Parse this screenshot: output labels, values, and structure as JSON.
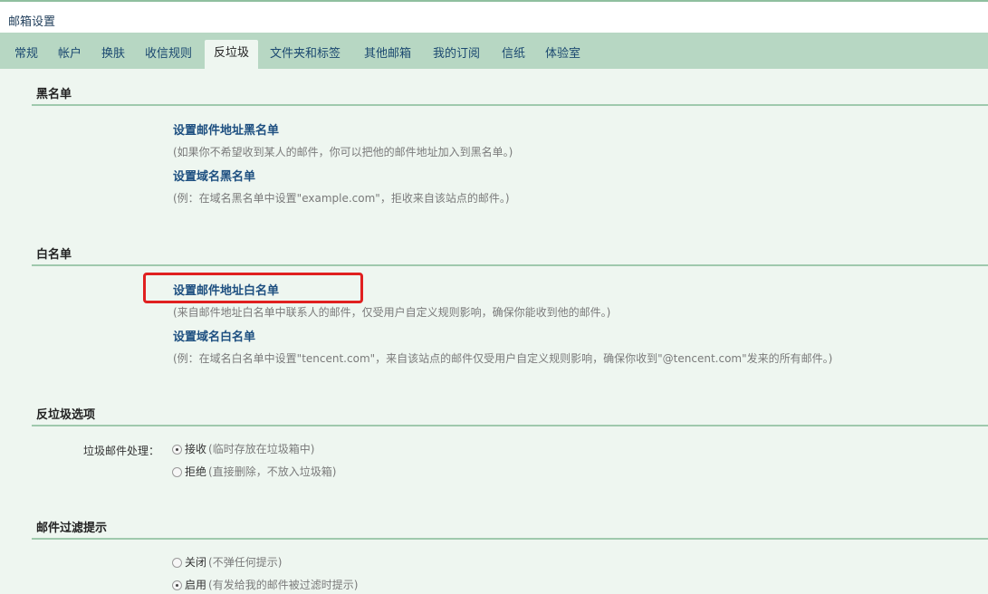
{
  "header": {
    "title": "邮箱设置"
  },
  "tabs": [
    {
      "label": "常规"
    },
    {
      "label": "帐户"
    },
    {
      "label": "换肤"
    },
    {
      "label": "收信规则"
    },
    {
      "label": "反垃圾"
    },
    {
      "label": "文件夹和标签"
    },
    {
      "label": "其他邮箱"
    },
    {
      "label": "我的订阅"
    },
    {
      "label": "信纸"
    },
    {
      "label": "体验室"
    }
  ],
  "active_tab": "反垃圾",
  "blacklist": {
    "title": "黑名单",
    "address_link": "设置邮件地址黑名单",
    "address_desc": "(如果你不希望收到某人的邮件，你可以把他的邮件地址加入到黑名单。)",
    "domain_link": "设置域名黑名单",
    "domain_desc": "(例：在域名黑名单中设置\"example.com\"，拒收来自该站点的邮件。)"
  },
  "whitelist": {
    "title": "白名单",
    "address_link": "设置邮件地址白名单",
    "address_desc": "(来自邮件地址白名单中联系人的邮件，仅受用户自定义规则影响，确保你能收到他的邮件。)",
    "domain_link": "设置域名白名单",
    "domain_desc": "(例：在域名白名单中设置\"tencent.com\"，来自该站点的邮件仅受用户自定义规则影响，确保你收到\"@tencent.com\"发来的所有邮件。)"
  },
  "antispam": {
    "title": "反垃圾选项",
    "field_label": "垃圾邮件处理：",
    "options": [
      {
        "label": "接收",
        "note": "(临时存放在垃圾箱中)",
        "checked": true
      },
      {
        "label": "拒绝",
        "note": "(直接删除，不放入垃圾箱)",
        "checked": false
      }
    ]
  },
  "filter_notice": {
    "title": "邮件过滤提示",
    "options": [
      {
        "label": "关闭",
        "note": "(不弹任何提示)",
        "checked": false
      },
      {
        "label": "启用",
        "note": "(有发给我的邮件被过滤时提示)",
        "checked": true
      }
    ]
  },
  "colors": {
    "tabbar": "#b7d7c3",
    "content_bg": "#eef6f0",
    "link": "#1d4f80",
    "highlight": "#e02020"
  }
}
